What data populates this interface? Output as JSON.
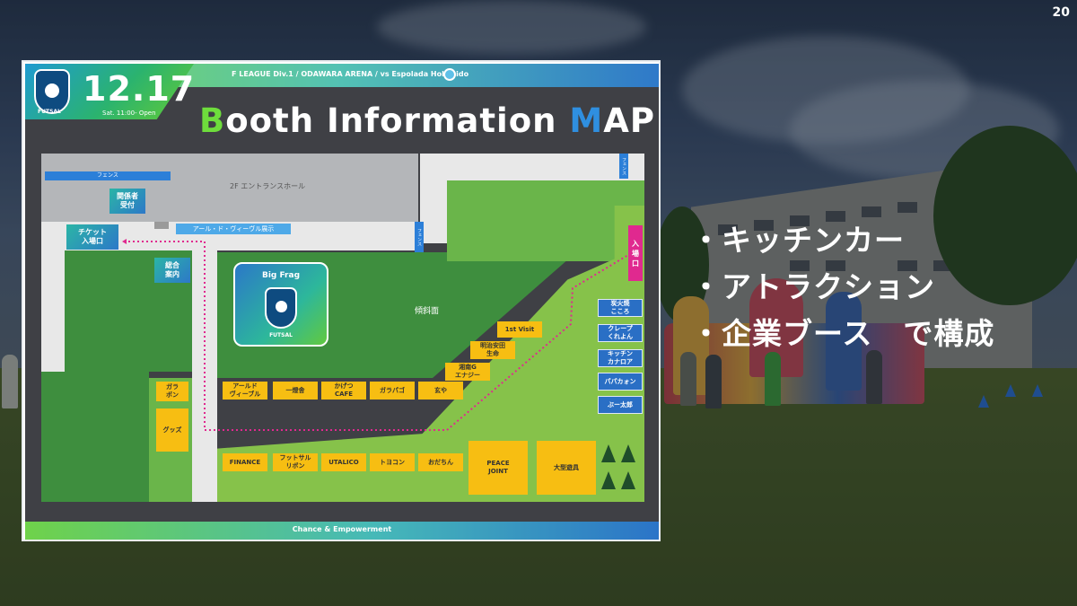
{
  "page_number": "20",
  "bullets": [
    "・キッチンカー",
    "・アトラクション",
    "・企業ブース　で構成"
  ],
  "map": {
    "date": "12.17",
    "time": "Sat. 11:00- Open",
    "league": "F LEAGUE Div.1 / ODAWARA  ARENA / vs Espolada Hokkaido",
    "title_first": "B",
    "title_mid": "ooth Information ",
    "title_m": "M",
    "title_end": "AP",
    "emblem_tag": "FUTSAL",
    "footer": "Chance & Empowerment",
    "fence_top": "フェンス",
    "fence_right_top": "フェンス",
    "fence_mid": "フェンス",
    "entrance_hall": "2F エントランスホール",
    "staff_reception": "関係者\n受付",
    "ticket_gate": "チケット\n入場口",
    "art_exhibit": "アール・ド・ヴィーヴル展示",
    "info": "総合\n案内",
    "big_frag_title": "Big Frag",
    "big_frag_tag": "FUTSAL",
    "slope": "傾斜面",
    "entrance": "入\n場\n口",
    "booths": [
      "ガラ\nポン",
      "グッズ",
      "アールド\nヴィーブル",
      "一燈舎",
      "かげつ\nCAFE",
      "ガラパゴ",
      "玄や",
      "FINANCE",
      "フットサル\nリボン",
      "UTALICO",
      "トヨコン",
      "おだちん",
      "PEACE\nJOINT",
      "大型遊具",
      "1st Visit",
      "明治安田\n生命",
      "湘南G\nエナジー"
    ],
    "food_trucks": [
      "炭火焼\nこころ",
      "クレープ\nくれよん",
      "キッチン\nカナロア",
      "パパカォン",
      "ぶー太郎"
    ]
  }
}
